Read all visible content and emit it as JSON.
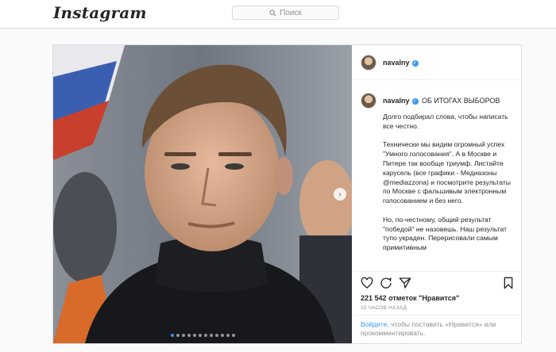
{
  "topbar": {
    "logo_text": "Instagram",
    "search_placeholder": "Поиск",
    "search_icon": "search-icon"
  },
  "post": {
    "username": "navalny",
    "verified": true,
    "caption_title": "ОБ ИТОГАХ ВЫБОРОВ",
    "caption_paragraphs": [
      "Долго подбирал слова, чтобы написать все честно.",
      "Технически мы видим огромный успех \"Умного голосования\". А в Москве и Питере так вообще триумф. Листайте карусель (все графики - Медиазоны @mediazzona) и посмотрите результаты по Москве с фальшивым электронным голосованием и без него.",
      "Но, по-честному, общий результат \"победой\" не назовешь. Наш результат тупо украден. Перерисовали самым примитивным"
    ],
    "carousel": {
      "total_slides": 12,
      "active_slide": 1
    },
    "likes_count": "221 542",
    "likes_label": "отметок \"Нравится\"",
    "time_ago": "22 часов назад",
    "login_prompt": {
      "link_text": "Войдите",
      "rest_text": ", чтобы поставить «Нравится» или прокомментировать."
    },
    "icons": [
      "heart-icon",
      "comment-icon",
      "share-icon",
      "bookmark-icon"
    ],
    "colors": {
      "accent": "#3897f0",
      "border": "#dbdbdb",
      "muted": "#8e8e8e",
      "text": "#262626"
    }
  }
}
